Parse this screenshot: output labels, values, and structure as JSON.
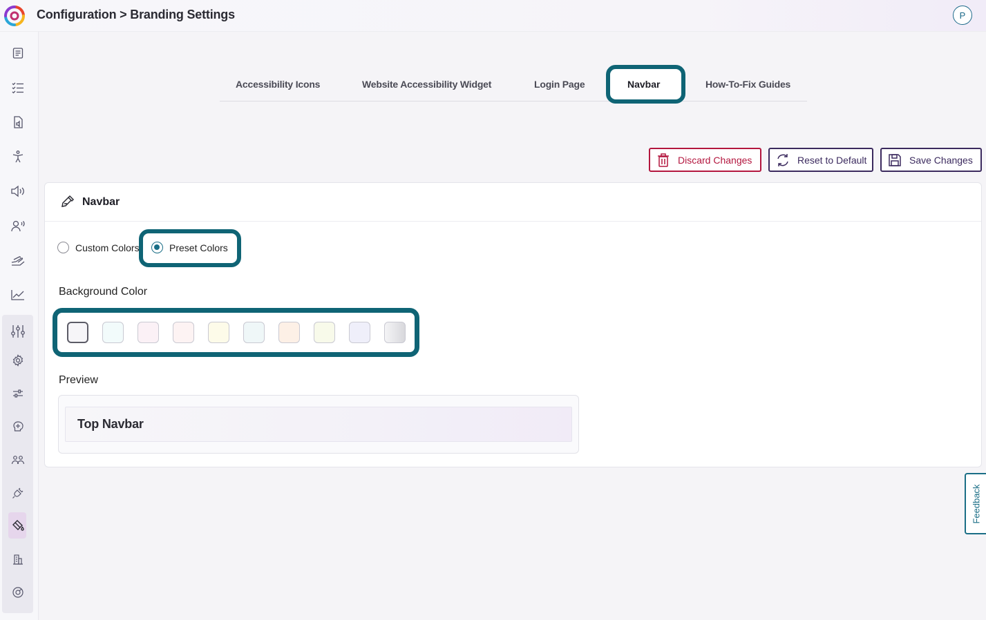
{
  "header": {
    "title": "Configuration > Branding Settings",
    "avatar_initial": "P"
  },
  "sidebar": {
    "icons": [
      "document-icon",
      "checklist-icon",
      "audio-file-icon",
      "accessibility-icon",
      "speaker-icon",
      "voice-user-icon",
      "hand-icon",
      "chart-icon",
      "sliders-icon",
      "gear-icon",
      "tune-icon",
      "brain-icon",
      "team-icon",
      "plug-icon",
      "paint-bucket-icon",
      "building-icon",
      "support-icon"
    ],
    "active": "paint-bucket-icon"
  },
  "tabs": [
    {
      "label": "Accessibility Icons"
    },
    {
      "label": "Website Accessibility Widget"
    },
    {
      "label": "Login Page"
    },
    {
      "label": "Navbar",
      "active": true
    },
    {
      "label": "How-To-Fix Guides"
    }
  ],
  "actions": {
    "discard_label": "Discard Changes",
    "reset_label": "Reset to Default",
    "save_label": "Save Changes"
  },
  "card": {
    "title": "Navbar",
    "mode_options": [
      {
        "label": "Custom Colors",
        "checked": false
      },
      {
        "label": "Preset Colors",
        "checked": true
      }
    ],
    "background_label": "Background Color",
    "swatches": [
      "#f6f5f8",
      "#f2fbfb",
      "#fbf1f6",
      "#fdf3f3",
      "#fdfbe9",
      "#eff7f8",
      "#fdf0e6",
      "#f8faea",
      "#efeffa",
      "#e6e6e8"
    ],
    "selected_swatch": 0,
    "preview_label": "Preview",
    "preview_text": "Top Navbar"
  },
  "feedback_label": "Feedback",
  "colors": {
    "accent": "#0f6475",
    "danger": "#b3163e",
    "primary": "#3b2a5e"
  }
}
